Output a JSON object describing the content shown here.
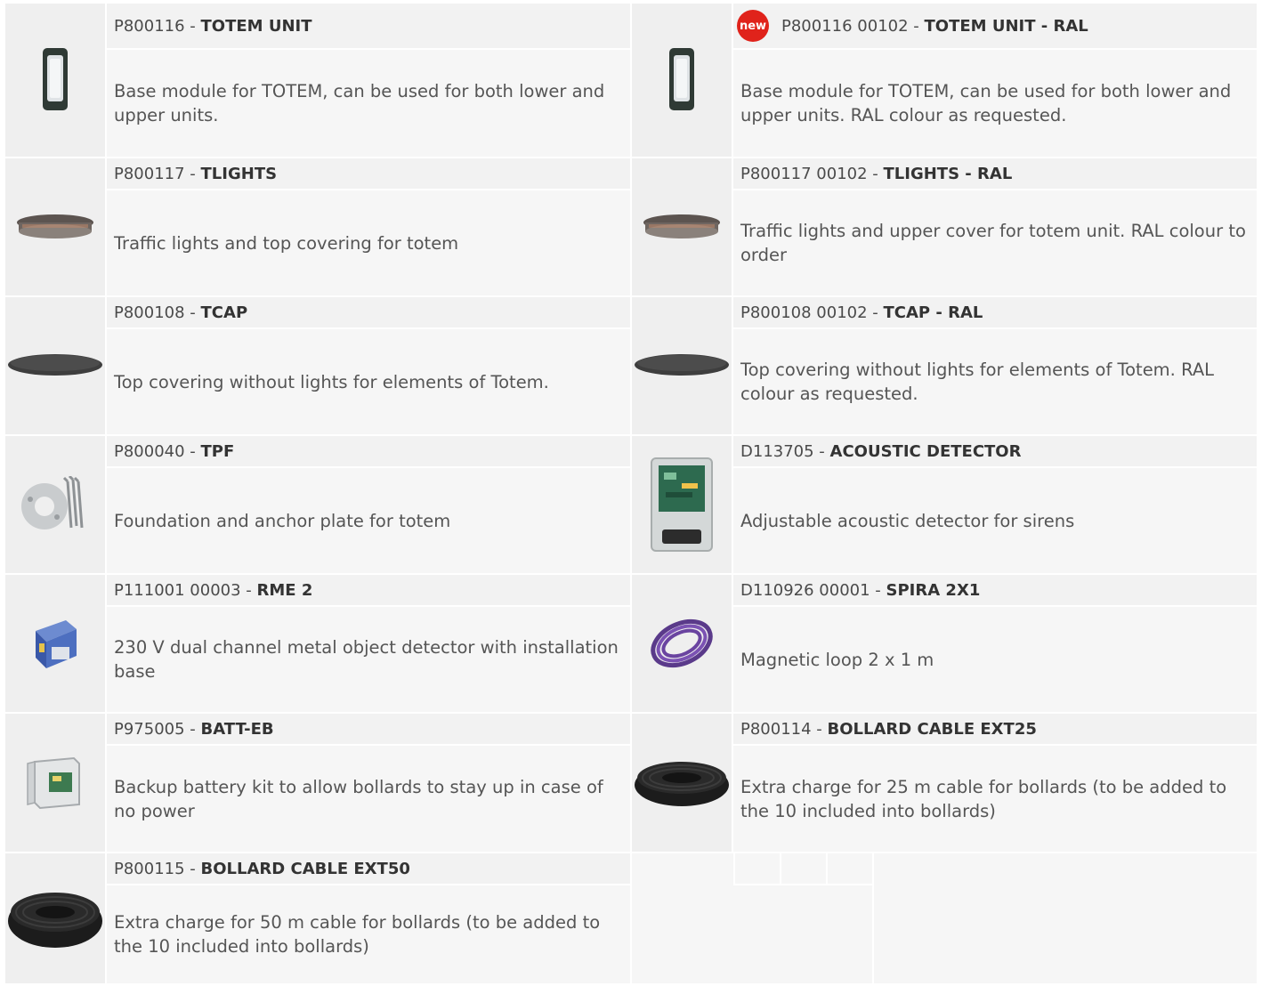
{
  "rows": [
    {
      "left": {
        "code": "P800116 - ",
        "name": "TOTEM UNIT",
        "description": "Base module for TOTEM, can be used for both lower and upper units.",
        "icon": "totem-unit-icon"
      },
      "right": {
        "badge": "new",
        "code": "P800116 00102 - ",
        "name": "TOTEM UNIT - RAL",
        "description": "Base module for TOTEM, can be used for both lower and upper units. RAL colour as requested.",
        "icon": "totem-unit-icon"
      }
    },
    {
      "left": {
        "code": "P800117 - ",
        "name": "TLIGHTS",
        "description": "Traffic lights and top covering for totem",
        "icon": "tlights-icon"
      },
      "right": {
        "code": "P800117 00102 - ",
        "name": "TLIGHTS - RAL",
        "description": "Traffic lights and upper cover for totem unit. RAL colour to order",
        "icon": "tlights-icon"
      }
    },
    {
      "left": {
        "code": "P800108 - ",
        "name": "TCAP",
        "description": "Top covering without lights for elements of Totem.",
        "icon": "tcap-icon"
      },
      "right": {
        "code": "P800108 00102 - ",
        "name": "TCAP - RAL",
        "description": "Top covering without lights for elements of Totem. RAL colour as requested.",
        "icon": "tcap-icon"
      }
    },
    {
      "left": {
        "code": "P800040 - ",
        "name": "TPF",
        "description": "Foundation and anchor plate for totem",
        "icon": "anchor-plate-icon"
      },
      "right": {
        "code": "D113705 - ",
        "name": "ACOUSTIC DETECTOR",
        "description": "Adjustable acoustic detector for sirens",
        "icon": "acoustic-detector-icon"
      }
    },
    {
      "left": {
        "code": "P111001 00003 - ",
        "name": "RME 2",
        "description": "230 V dual channel metal object detector with installation base",
        "icon": "metal-detector-icon"
      },
      "right": {
        "code": "D110926 00001 - ",
        "name": "SPIRA 2X1",
        "description": "Magnetic loop 2 x 1 m",
        "icon": "magnetic-loop-icon"
      }
    },
    {
      "left": {
        "code": "P975005 - ",
        "name": "BATT-EB",
        "description": "Backup battery kit to allow bollards to stay up in case of no power",
        "icon": "battery-kit-icon"
      },
      "right": {
        "code": "P800114 - ",
        "name": "BOLLARD CABLE EXT25",
        "description": "Extra charge for 25 m cable for bollards (to be added to the 10 included into bollards)",
        "icon": "cable-coil-icon"
      }
    },
    {
      "left": {
        "code": "P800115 - ",
        "name": "BOLLARD CABLE EXT50",
        "description": "Extra charge for 50 m cable for bollards (to be added to the 10 included into bollards)",
        "icon": "cable-coil-icon"
      }
    }
  ]
}
